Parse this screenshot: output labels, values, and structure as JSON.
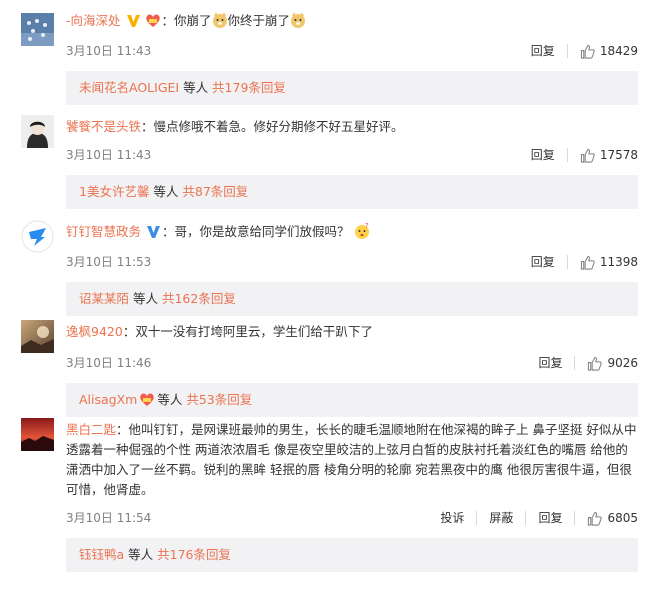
{
  "comments": [
    {
      "username": "-向海深处",
      "verified": "yellow",
      "colon": "：",
      "text_before": "你崩了",
      "text_middle": "你终于崩了",
      "time": "3月10日 11:43",
      "reply_label": "回复",
      "likes": "18429",
      "reply_summary": {
        "name": "未闻花名AOLIGEI",
        "mid": " 等人 ",
        "count": "共179条回复"
      }
    },
    {
      "username": "饕餮不是头铁",
      "colon": "：",
      "text": "慢点修哦不着急。修好分期修不好五星好评。",
      "time": "3月10日 11:43",
      "reply_label": "回复",
      "likes": "17578",
      "reply_summary": {
        "name": "1美女许艺馨",
        "mid": " 等人 ",
        "count": "共87条回复"
      }
    },
    {
      "username": "钉钉智慧政务",
      "verified": "blue",
      "colon": "：",
      "text": "哥，你是故意给同学们放假吗？",
      "time": "3月10日 11:53",
      "reply_label": "回复",
      "likes": "11398",
      "reply_summary": {
        "name": "诏某某陌",
        "mid": " 等人 ",
        "count": "共162条回复"
      }
    },
    {
      "username": "逸枫9420",
      "colon": "：",
      "text": "双十一没有打垮阿里云，学生们给干趴下了",
      "time": "3月10日 11:46",
      "reply_label": "回复",
      "likes": "9026",
      "reply_summary": {
        "name": "AlisagXm",
        "mid": "等人 ",
        "count": "共53条回复"
      }
    },
    {
      "username": "黑白二匙",
      "colon": "：",
      "text": "他叫钉钉，是网课班最帅的男生，长长的睫毛温顺地附在他深褐的眸子上 鼻子坚挺 好似从中透露着一种倔强的个性 两道浓浓眉毛 像是夜空里皎洁的上弦月白皙的皮肤衬托着淡红色的嘴唇 给他的潇洒中加入了一丝不羁。锐利的黑眸 轻抿的唇 棱角分明的轮廓 宛若黑夜中的鹰 他很厉害很牛逼，但很可惜，他肾虚。",
      "time": "3月10日 11:54",
      "report_label": "投诉",
      "block_label": "屏蔽",
      "reply_label": "回复",
      "likes": "6805",
      "reply_summary": {
        "name": "钰钰鸭a",
        "mid": " 等人 ",
        "count": "共176条回复"
      }
    }
  ],
  "colors": {
    "username": "#eb7350",
    "time": "#808080",
    "reply_bg": "#f2f2f5",
    "verified_yellow": "#f7b100",
    "verified_blue": "#3a8ee6"
  }
}
